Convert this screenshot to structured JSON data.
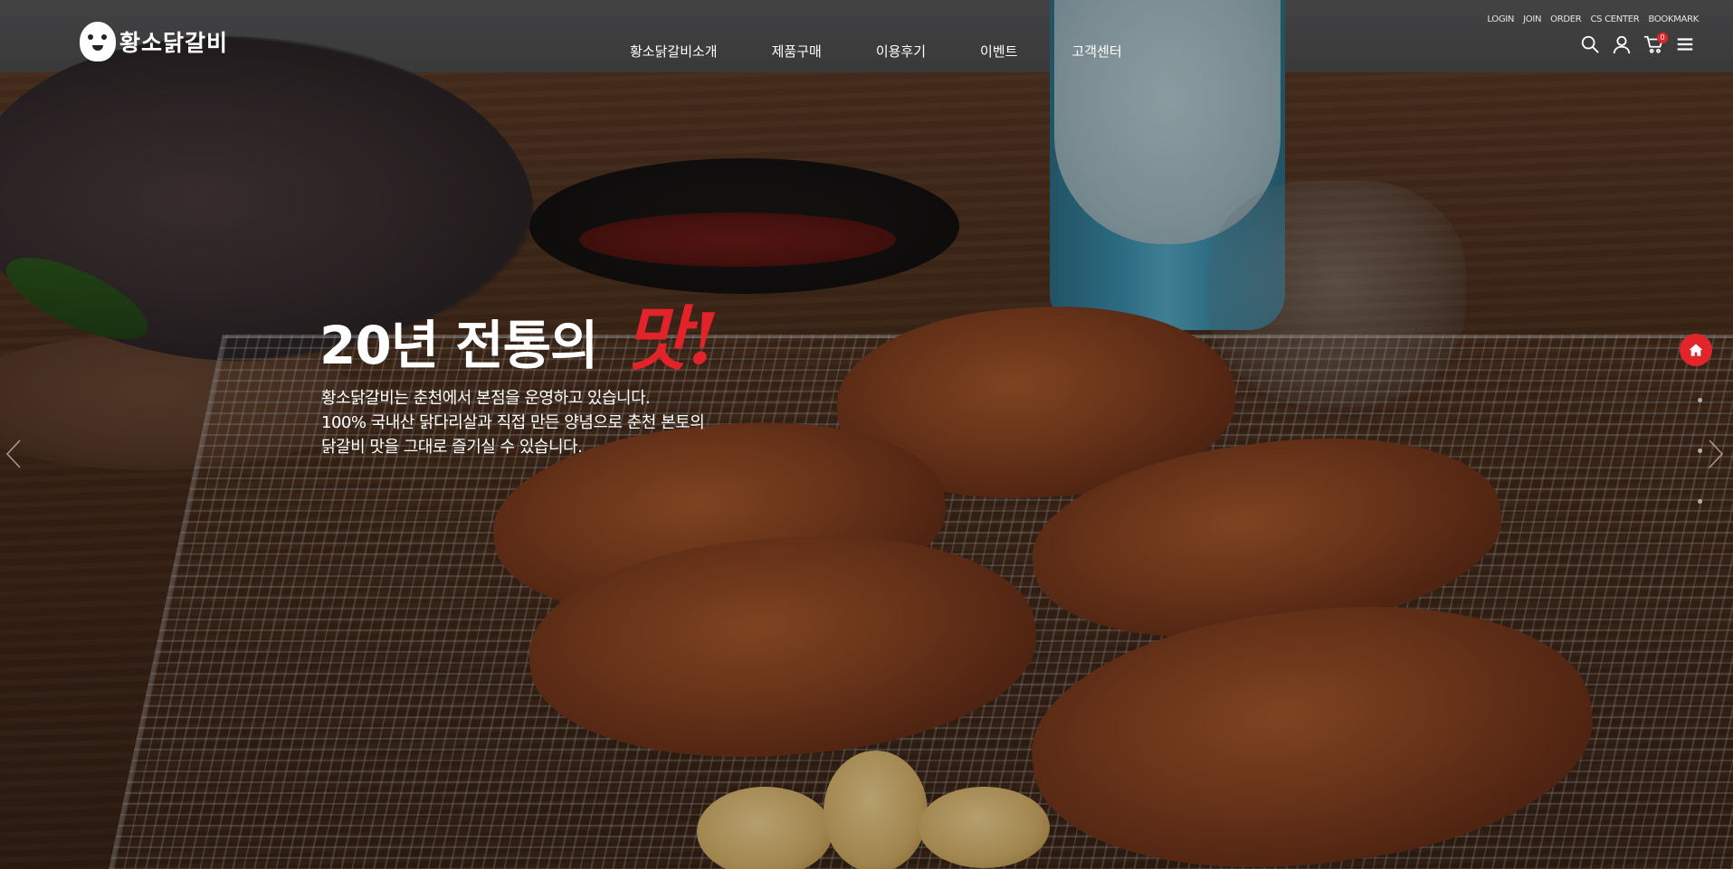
{
  "brand": {
    "logo_text": "황소닭갈비"
  },
  "nav": {
    "items": [
      {
        "label": "황소닭갈비소개"
      },
      {
        "label": "제품구매"
      },
      {
        "label": "이용후기"
      },
      {
        "label": "이벤트"
      },
      {
        "label": "고객센터"
      }
    ]
  },
  "util_links": {
    "login": "LOGIN",
    "join": "JOIN",
    "order": "ORDER",
    "cs_center": "CS CENTER",
    "bookmark": "BOOKMARK"
  },
  "tools": {
    "search_icon": "search-icon",
    "user_icon": "user-icon",
    "cart_icon": "cart-icon",
    "cart_count": "0",
    "menu_icon": "hamburger-menu-icon"
  },
  "hero": {
    "headline_main": "20년 전통의",
    "headline_accent": "맛!",
    "desc_lines": [
      "황소닭갈비는 춘천에서 본점을 운영하고 있습니다.",
      "100% 국내산 닭다리살과 직접 만든 양념으로 춘천 본토의",
      "닭갈비 맛을 그대로 즐기실 수 있습니다."
    ]
  },
  "colors": {
    "accent": "#e2232a",
    "badge": "#e0262b",
    "text": "#ffffff"
  }
}
